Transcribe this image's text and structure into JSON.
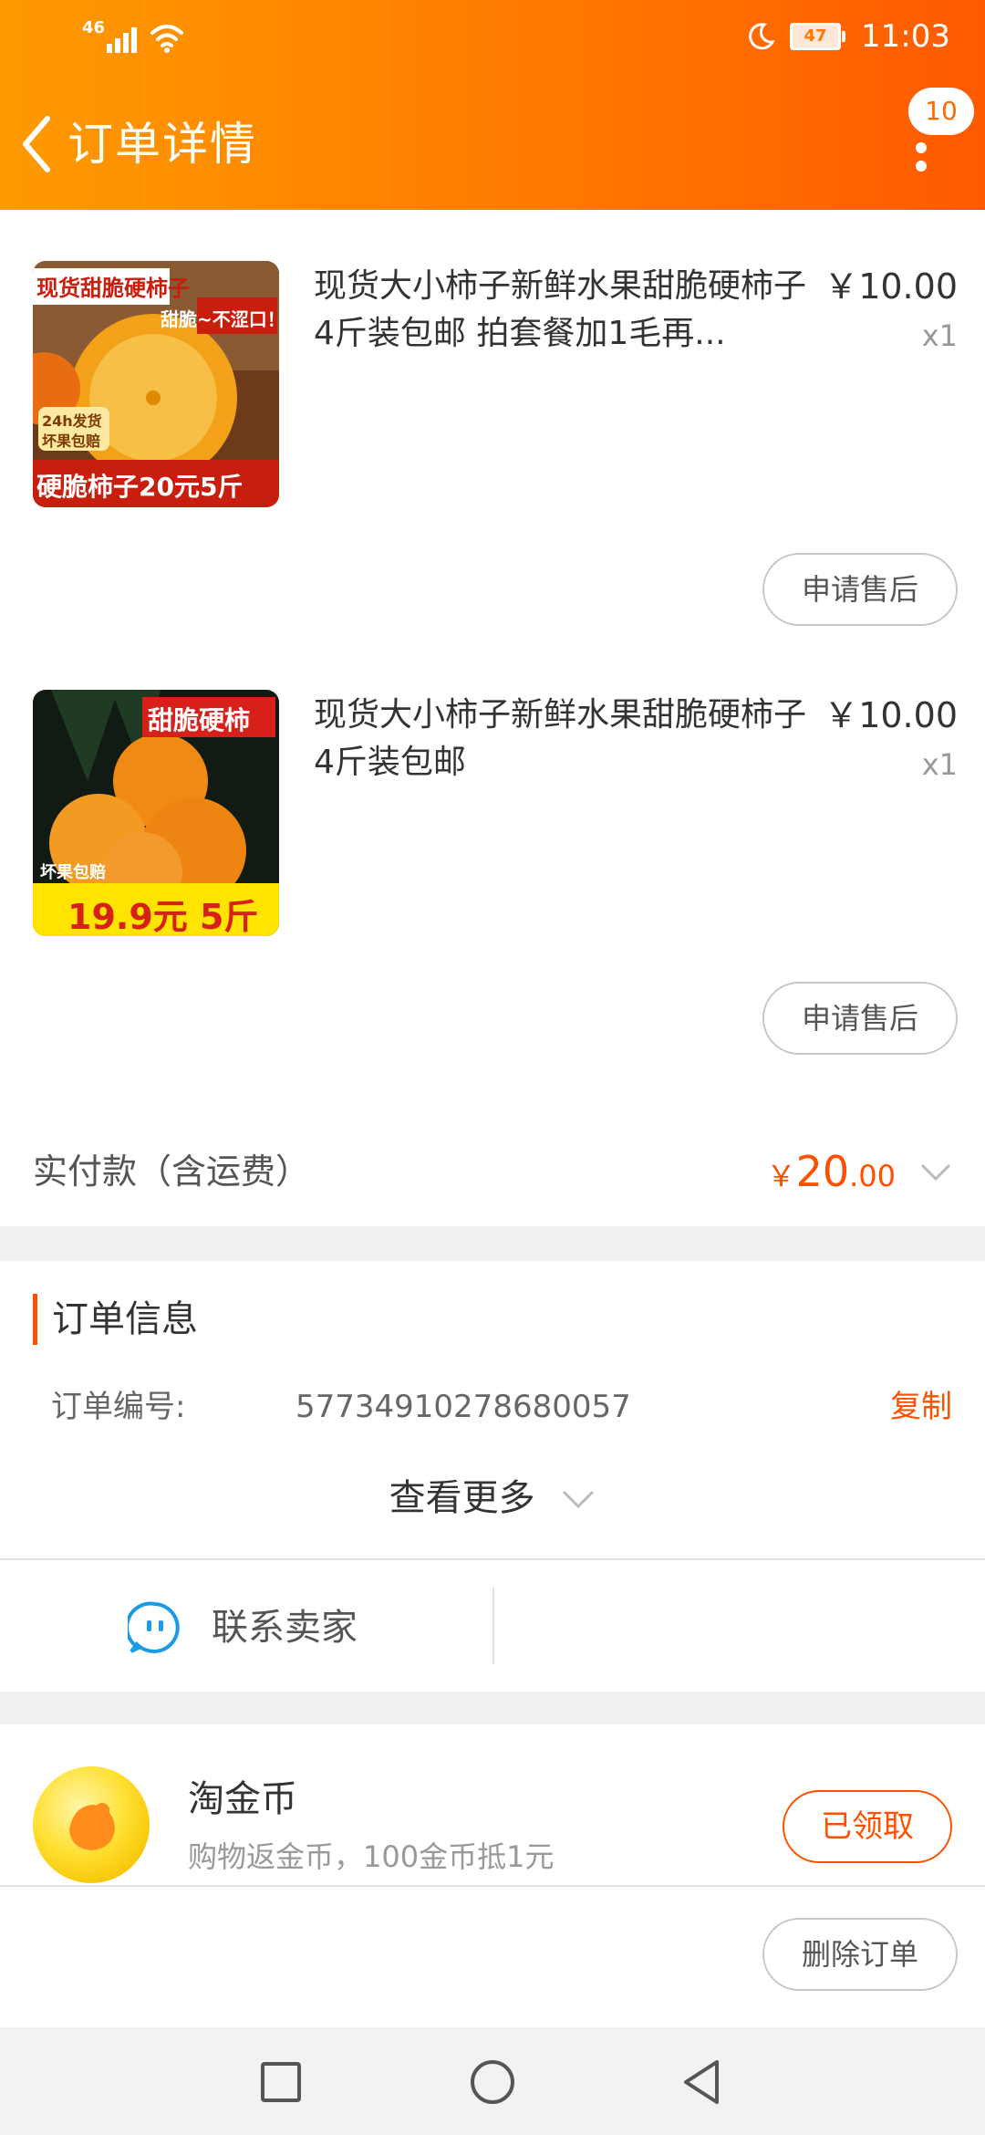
{
  "status_bar": {
    "network": "46",
    "battery": "47",
    "time": "11:03"
  },
  "header": {
    "title": "订单详情",
    "badge_count": "10"
  },
  "items": [
    {
      "name": "现货大小柿子新鲜水果甜脆硬柿子4斤装包邮 拍套餐加1毛再...",
      "price": "￥10.00",
      "qty": "x1",
      "after_sale_label": "申请售后",
      "image": {
        "top_text": "现货甜脆硬柿子",
        "sub_text": "甜脆~不涩口！",
        "badge_line1": "24h发货",
        "badge_line2": "坏果包赔",
        "banner": "硬脆柿子20元5斤"
      }
    },
    {
      "name": "现货大小柿子新鲜水果甜脆硬柿子4斤装包邮",
      "price": "￥10.00",
      "qty": "x1",
      "after_sale_label": "申请售后",
      "image": {
        "tag": "甜脆硬柿",
        "badge": "坏果包赔",
        "banner": "19.9元 5斤"
      }
    }
  ],
  "total": {
    "label": "实付款（含运费）",
    "currency": "￥",
    "integer": "20",
    "decimal": ".00"
  },
  "order_info": {
    "title": "订单信息",
    "order_no_label": "订单编号:",
    "order_no": "57734910278680057",
    "copy_label": "复制",
    "view_more_label": "查看更多"
  },
  "contact": {
    "label": "联系卖家"
  },
  "coins": {
    "title": "淘金币",
    "desc": "购物返金币，100金币抵1元",
    "button": "已领取"
  },
  "bottom": {
    "delete_label": "删除订单"
  },
  "colors": {
    "accent": "#ff5000",
    "header_start": "#ff9a00",
    "header_end": "#ff5a00"
  }
}
